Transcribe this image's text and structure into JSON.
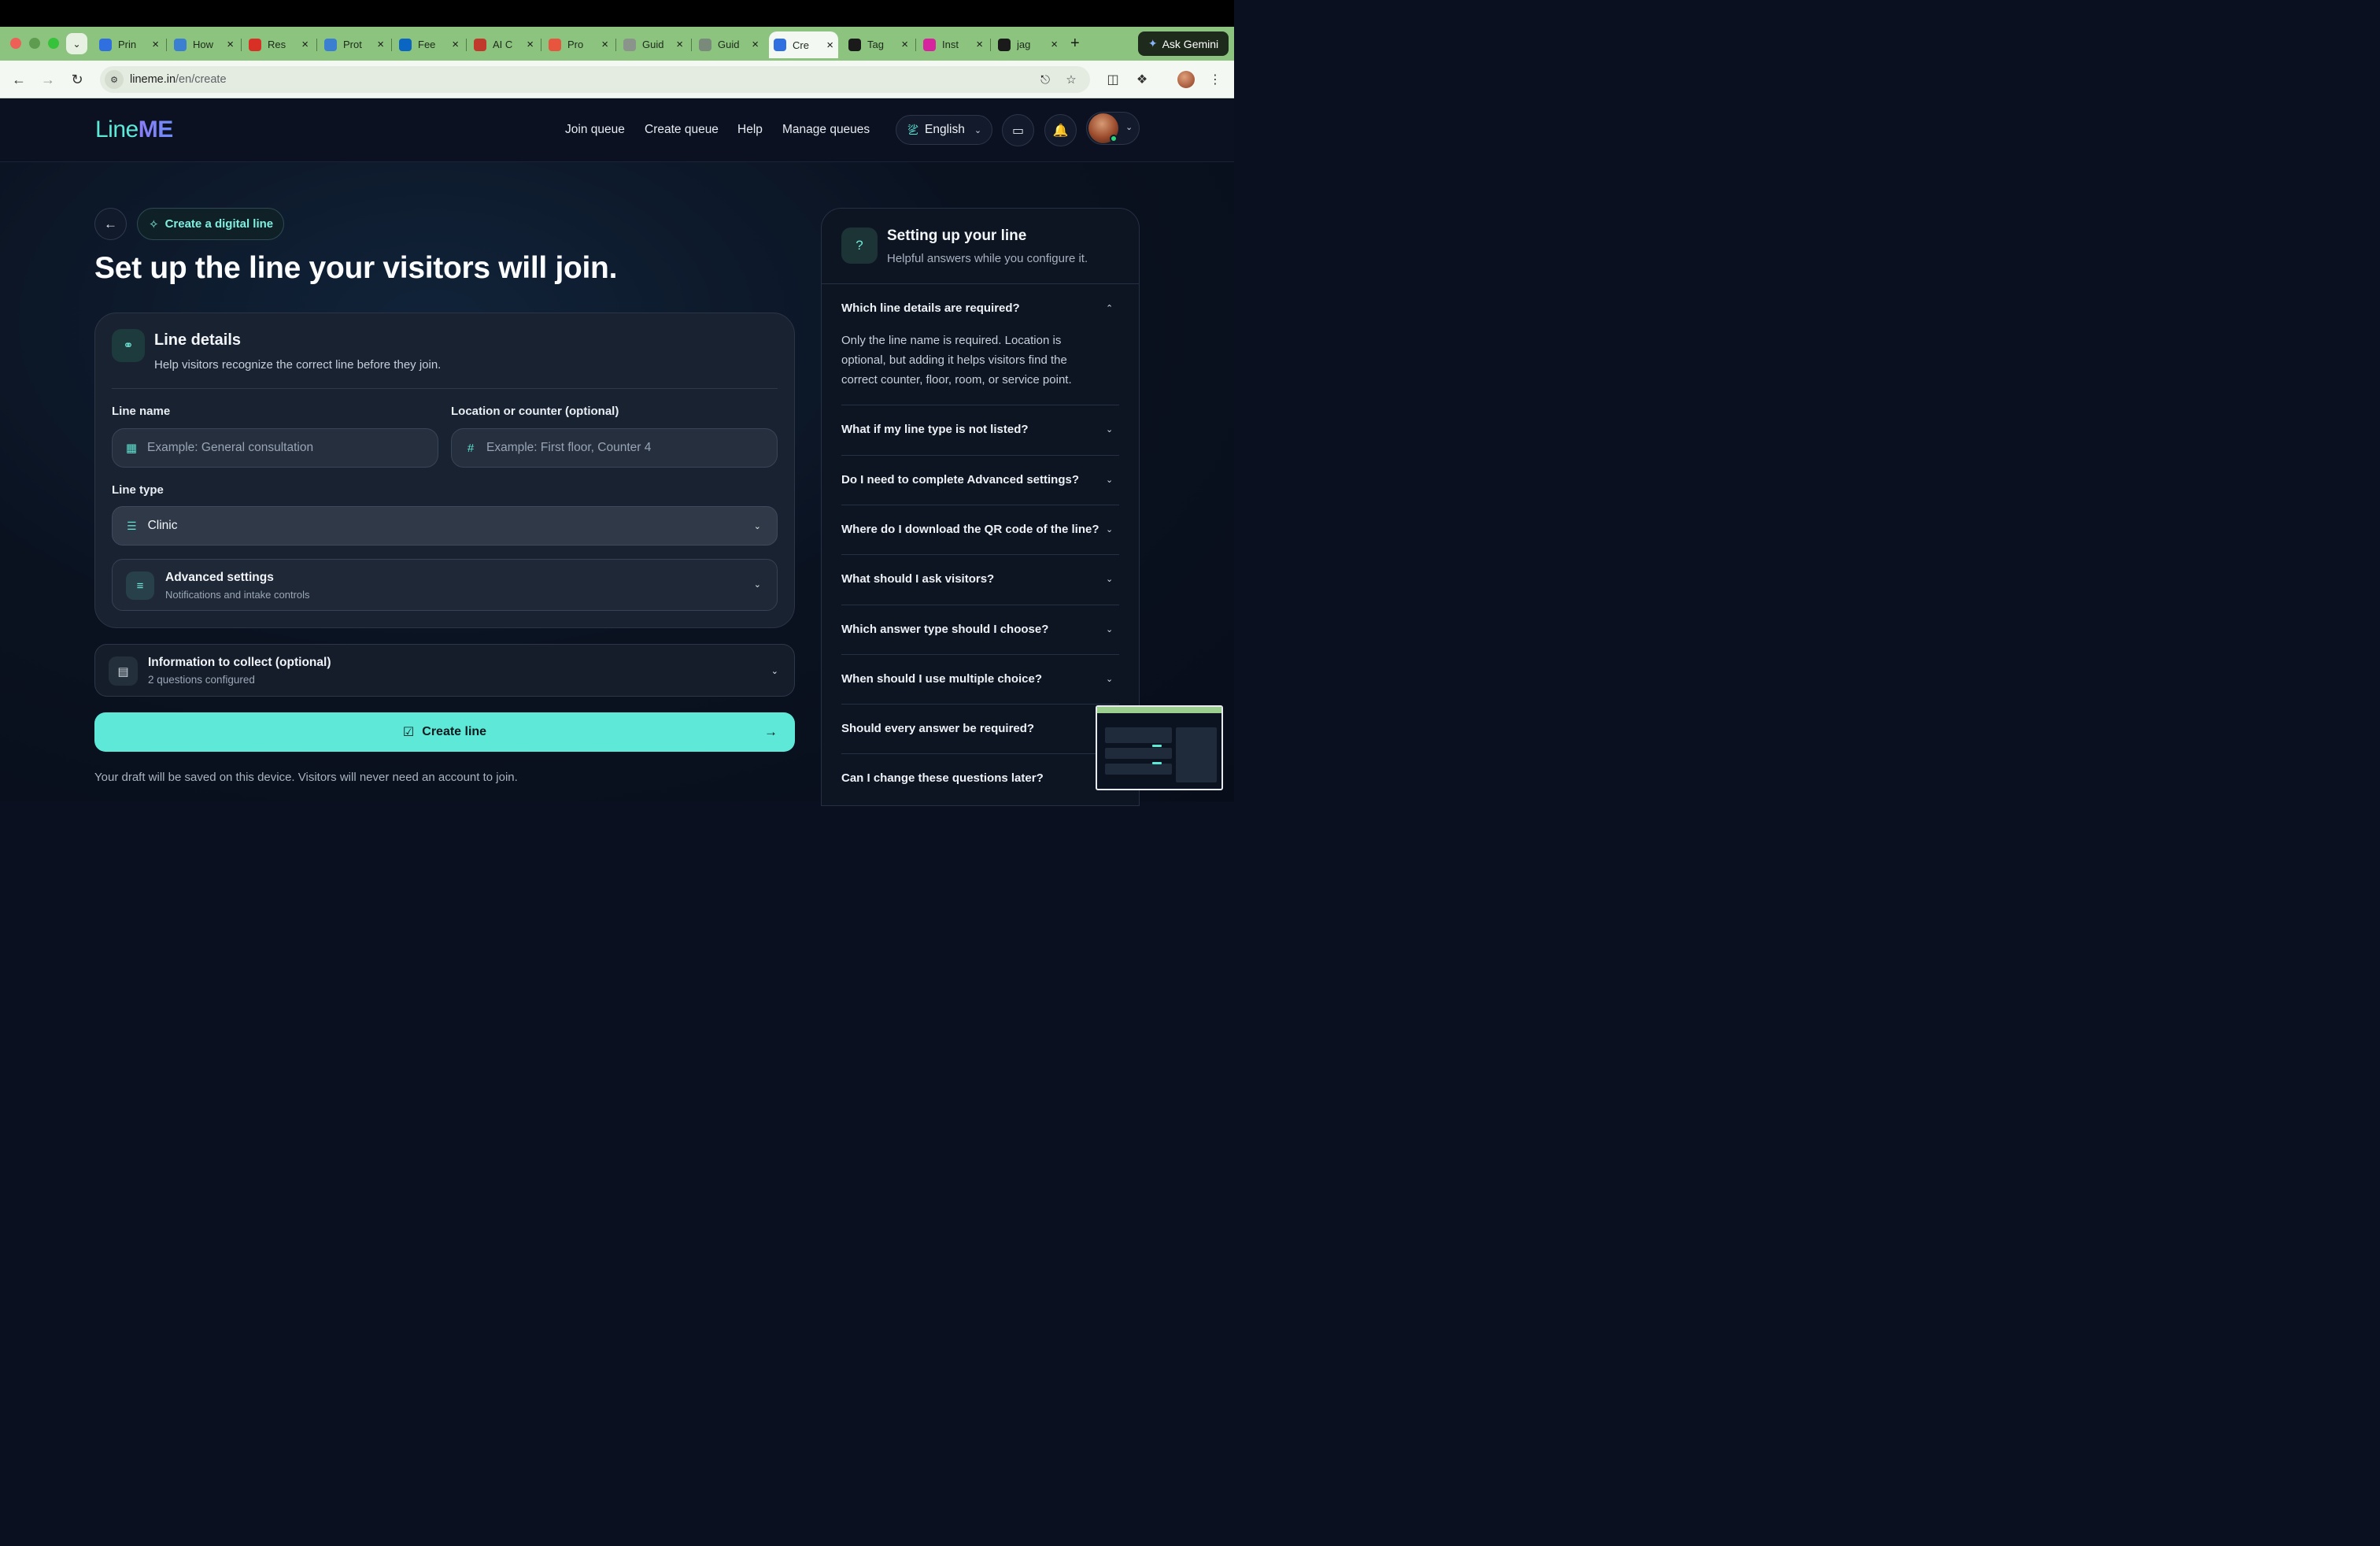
{
  "browser": {
    "tabs": [
      {
        "title": "Prin",
        "favicon": "play-icon",
        "color": "#2f6fe0"
      },
      {
        "title": "How",
        "favicon": "bbn-icon",
        "color": "#3a7fd0"
      },
      {
        "title": "Res",
        "favicon": "gmail-icon",
        "color": "#d93025"
      },
      {
        "title": "Prot",
        "favicon": "bbn-icon",
        "color": "#3a7fd0"
      },
      {
        "title": "Fee",
        "favicon": "linkedin-icon",
        "color": "#0a66c2"
      },
      {
        "title": "AI C",
        "favicon": "rocket-icon",
        "color": "#c0392b"
      },
      {
        "title": "Pro",
        "favicon": "producthunt-icon",
        "color": "#e8553e"
      },
      {
        "title": "Guid",
        "favicon": "loading-icon",
        "color": "#8a948a"
      },
      {
        "title": "Guid",
        "favicon": "gemini-icon",
        "color": "#7a8a7a"
      },
      {
        "title": "Cre",
        "favicon": "lineme-icon",
        "color": "#2f6fe0"
      },
      {
        "title": "Tag",
        "favicon": "chatgpt-icon",
        "color": "#1a1a1a"
      },
      {
        "title": "Inst",
        "favicon": "instagram-icon",
        "color": "#d6249f"
      },
      {
        "title": "jag",
        "favicon": "github-icon",
        "color": "#1a1a1a"
      }
    ],
    "active_tab_index": 9,
    "ask_gemini_label": "Ask Gemini",
    "url_host": "lineme.in",
    "url_path": "/en/create"
  },
  "header": {
    "logo_line": "Line",
    "logo_me": "ME",
    "nav": [
      "Join queue",
      "Create queue",
      "Help",
      "Manage queues"
    ],
    "language": "English"
  },
  "page": {
    "chip_label": "Create a digital line",
    "title": "Set up the line your visitors will join."
  },
  "line_details": {
    "title": "Line details",
    "subtitle": "Help visitors recognize the correct line before they join.",
    "name_label": "Line name",
    "name_placeholder": "Example: General consultation",
    "location_label": "Location or counter (optional)",
    "location_placeholder": "Example: First floor, Counter 4",
    "type_label": "Line type",
    "type_value": "Clinic",
    "advanced_title": "Advanced settings",
    "advanced_subtitle": "Notifications and intake controls"
  },
  "info_collect": {
    "title": "Information to collect (optional)",
    "subtitle": "2 questions configured"
  },
  "create_button": "Create line",
  "footnote": "Your draft will be saved on this device. Visitors will never need an account to join.",
  "help_panel": {
    "title": "Setting up your line",
    "subtitle": "Helpful answers while you configure it.",
    "faqs": [
      {
        "q": "Which line details are required?",
        "expanded": true,
        "a": "Only the line name is required. Location is optional, but adding it helps visitors find the correct counter, floor, room, or service point."
      },
      {
        "q": "What if my line type is not listed?",
        "expanded": false
      },
      {
        "q": "Do I need to complete Advanced settings?",
        "expanded": false
      },
      {
        "q": "Where do I download the QR code of the line?",
        "expanded": false
      },
      {
        "q": "What should I ask visitors?",
        "expanded": false
      },
      {
        "q": "Which answer type should I choose?",
        "expanded": false
      },
      {
        "q": "When should I use multiple choice?",
        "expanded": false
      },
      {
        "q": "Should every answer be required?",
        "expanded": false
      },
      {
        "q": "Can I change these questions later?",
        "expanded": false
      }
    ]
  },
  "colors": {
    "accent": "#5ee8d8",
    "background": "#0a1020",
    "card": "#192231"
  }
}
